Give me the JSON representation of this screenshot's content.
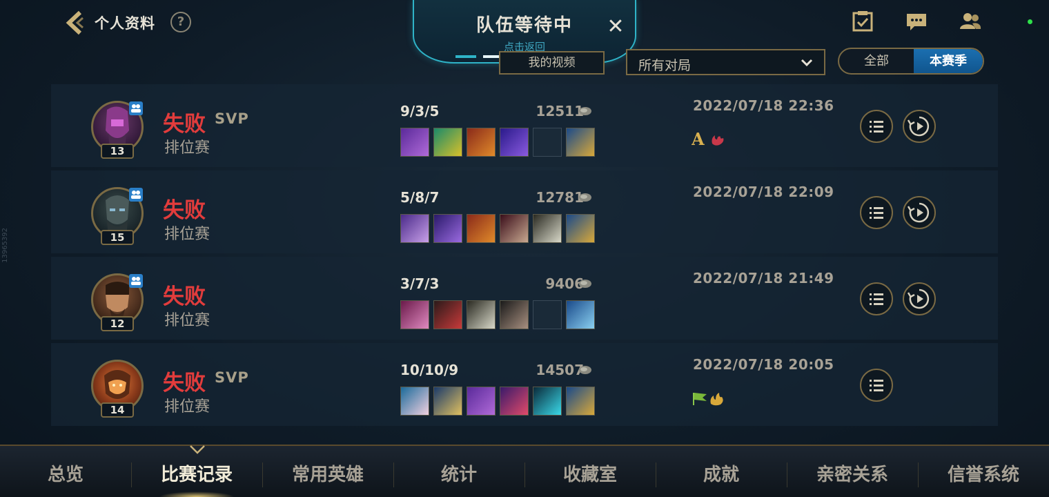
{
  "header": {
    "title": "个人资料",
    "help_label": "?"
  },
  "queue": {
    "title": "队伍等待中",
    "subtitle": "点击返回",
    "close_label": "✕"
  },
  "filters": {
    "video_label": "我的视频",
    "match_type_selected": "所有对局",
    "season_options": [
      "全部",
      "本赛季"
    ],
    "season_selected": "本赛季"
  },
  "side_id": "13965392",
  "matches": [
    {
      "champion_level": "13",
      "result": "失败",
      "svp": "SVP",
      "mode": "排位赛",
      "kda": "9/3/5",
      "gold": "12511",
      "date": "2022/07/18 22:36",
      "honors": [
        "A-rank-icon",
        "red-flame-icon"
      ],
      "has_replay": true
    },
    {
      "champion_level": "15",
      "result": "失败",
      "svp": "",
      "mode": "排位赛",
      "kda": "5/8/7",
      "gold": "12781",
      "date": "2022/07/18 22:09",
      "honors": [],
      "has_replay": true
    },
    {
      "champion_level": "12",
      "result": "失败",
      "svp": "",
      "mode": "排位赛",
      "kda": "3/7/3",
      "gold": "9406",
      "date": "2022/07/18 21:49",
      "honors": [],
      "has_replay": true
    },
    {
      "champion_level": "14",
      "result": "失败",
      "svp": "SVP",
      "mode": "排位赛",
      "kda": "10/10/9",
      "gold": "14507",
      "date": "2022/07/18 20:05",
      "honors": [
        "green-flag-icon",
        "gold-flame-icon"
      ],
      "has_replay": false
    }
  ],
  "nav": {
    "items": [
      "总览",
      "比赛记录",
      "常用英雄",
      "统计",
      "收藏室",
      "成就",
      "亲密关系",
      "信誉系统"
    ],
    "active": "比赛记录"
  },
  "colors": {
    "loss": "#e23c3c",
    "accent_gold": "#7a6a44",
    "accent_cyan": "#2fb4c8",
    "season_active": "#1b6fb0"
  }
}
